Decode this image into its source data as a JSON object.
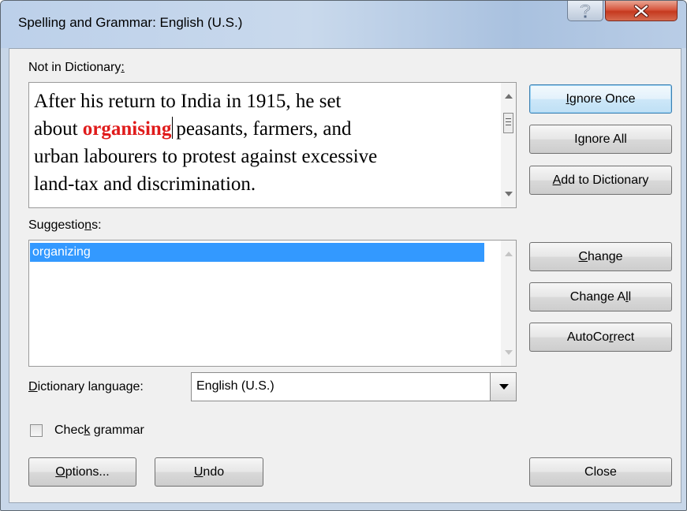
{
  "window": {
    "title": "Spelling and Grammar: English (U.S.)",
    "help_glyph": "?",
    "close_glyph": "X"
  },
  "not_in_dictionary": {
    "label_pre": "Not in Dictionary",
    "label_post": ":",
    "text_before_line1": "After his return to India in 1915, he set",
    "text_before_line2": "about ",
    "flagged_word": "organising",
    "text_after_line2": "peasants, farmers, and",
    "text_line3": "urban labourers to protest against excessive",
    "text_line4": "land-tax and discrimination."
  },
  "suggestions": {
    "label_pre": "Suggestio",
    "label_key": "n",
    "label_post": "s:",
    "items": [
      "organizing"
    ]
  },
  "buttons": {
    "ignore_once": {
      "pre": "",
      "key": "I",
      "post": "gnore Once"
    },
    "ignore_all": {
      "pre": "I",
      "key": "g",
      "post": "nore All"
    },
    "add_to_dictionary": {
      "pre": "",
      "key": "A",
      "post": "dd to Dictionary"
    },
    "change": {
      "pre": "",
      "key": "C",
      "post": "hange"
    },
    "change_all": {
      "pre": "Change A",
      "key": "l",
      "post": "l"
    },
    "autocorrect": {
      "pre": "AutoCo",
      "key": "r",
      "post": "rect"
    },
    "options": {
      "pre": "",
      "key": "O",
      "post": "ptions..."
    },
    "undo": {
      "pre": "",
      "key": "U",
      "post": "ndo"
    },
    "close": {
      "label": "Close"
    }
  },
  "dictionary_language": {
    "label_pre": "",
    "label_key": "D",
    "label_post": "ictionary language:",
    "selected": "English (U.S.)"
  },
  "check_grammar": {
    "label_pre": "Chec",
    "label_key": "k",
    "label_post": " grammar",
    "checked": false
  }
}
